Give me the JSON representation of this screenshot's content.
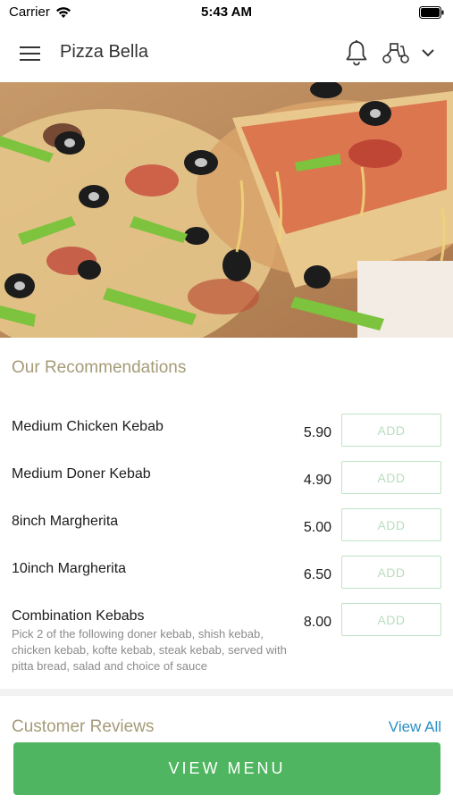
{
  "status_bar": {
    "carrier": "Carrier",
    "time": "5:43 AM"
  },
  "header": {
    "title": "Pizza Bella",
    "icons": [
      "menu-icon",
      "bell-icon",
      "scooter-icon",
      "chevron-down-icon"
    ]
  },
  "hero": {
    "image": "pizza-photo"
  },
  "recommendations": {
    "title": "Our Recommendations",
    "add_label": "ADD",
    "items": [
      {
        "name": "Medium Chicken Kebab",
        "price": "5.90",
        "description": ""
      },
      {
        "name": "Medium Doner Kebab",
        "price": "4.90",
        "description": ""
      },
      {
        "name": "8inch Margherita",
        "price": "5.00",
        "description": ""
      },
      {
        "name": "10inch Margherita",
        "price": "6.50",
        "description": ""
      },
      {
        "name": "Combination Kebabs",
        "price": "8.00",
        "description": "Pick 2 of the following doner kebab, shish kebab, chicken kebab, kofte kebab, steak kebab, served with pitta bread, salad and choice of sauce"
      }
    ]
  },
  "reviews": {
    "title": "Customer Reviews",
    "view_all": "View All"
  },
  "cta": {
    "label": "VIEW MENU"
  },
  "colors": {
    "accent_green": "#4fb560",
    "section_title": "#a59b78",
    "link_blue": "#2a8fc4",
    "add_border": "#bfe4c4"
  }
}
